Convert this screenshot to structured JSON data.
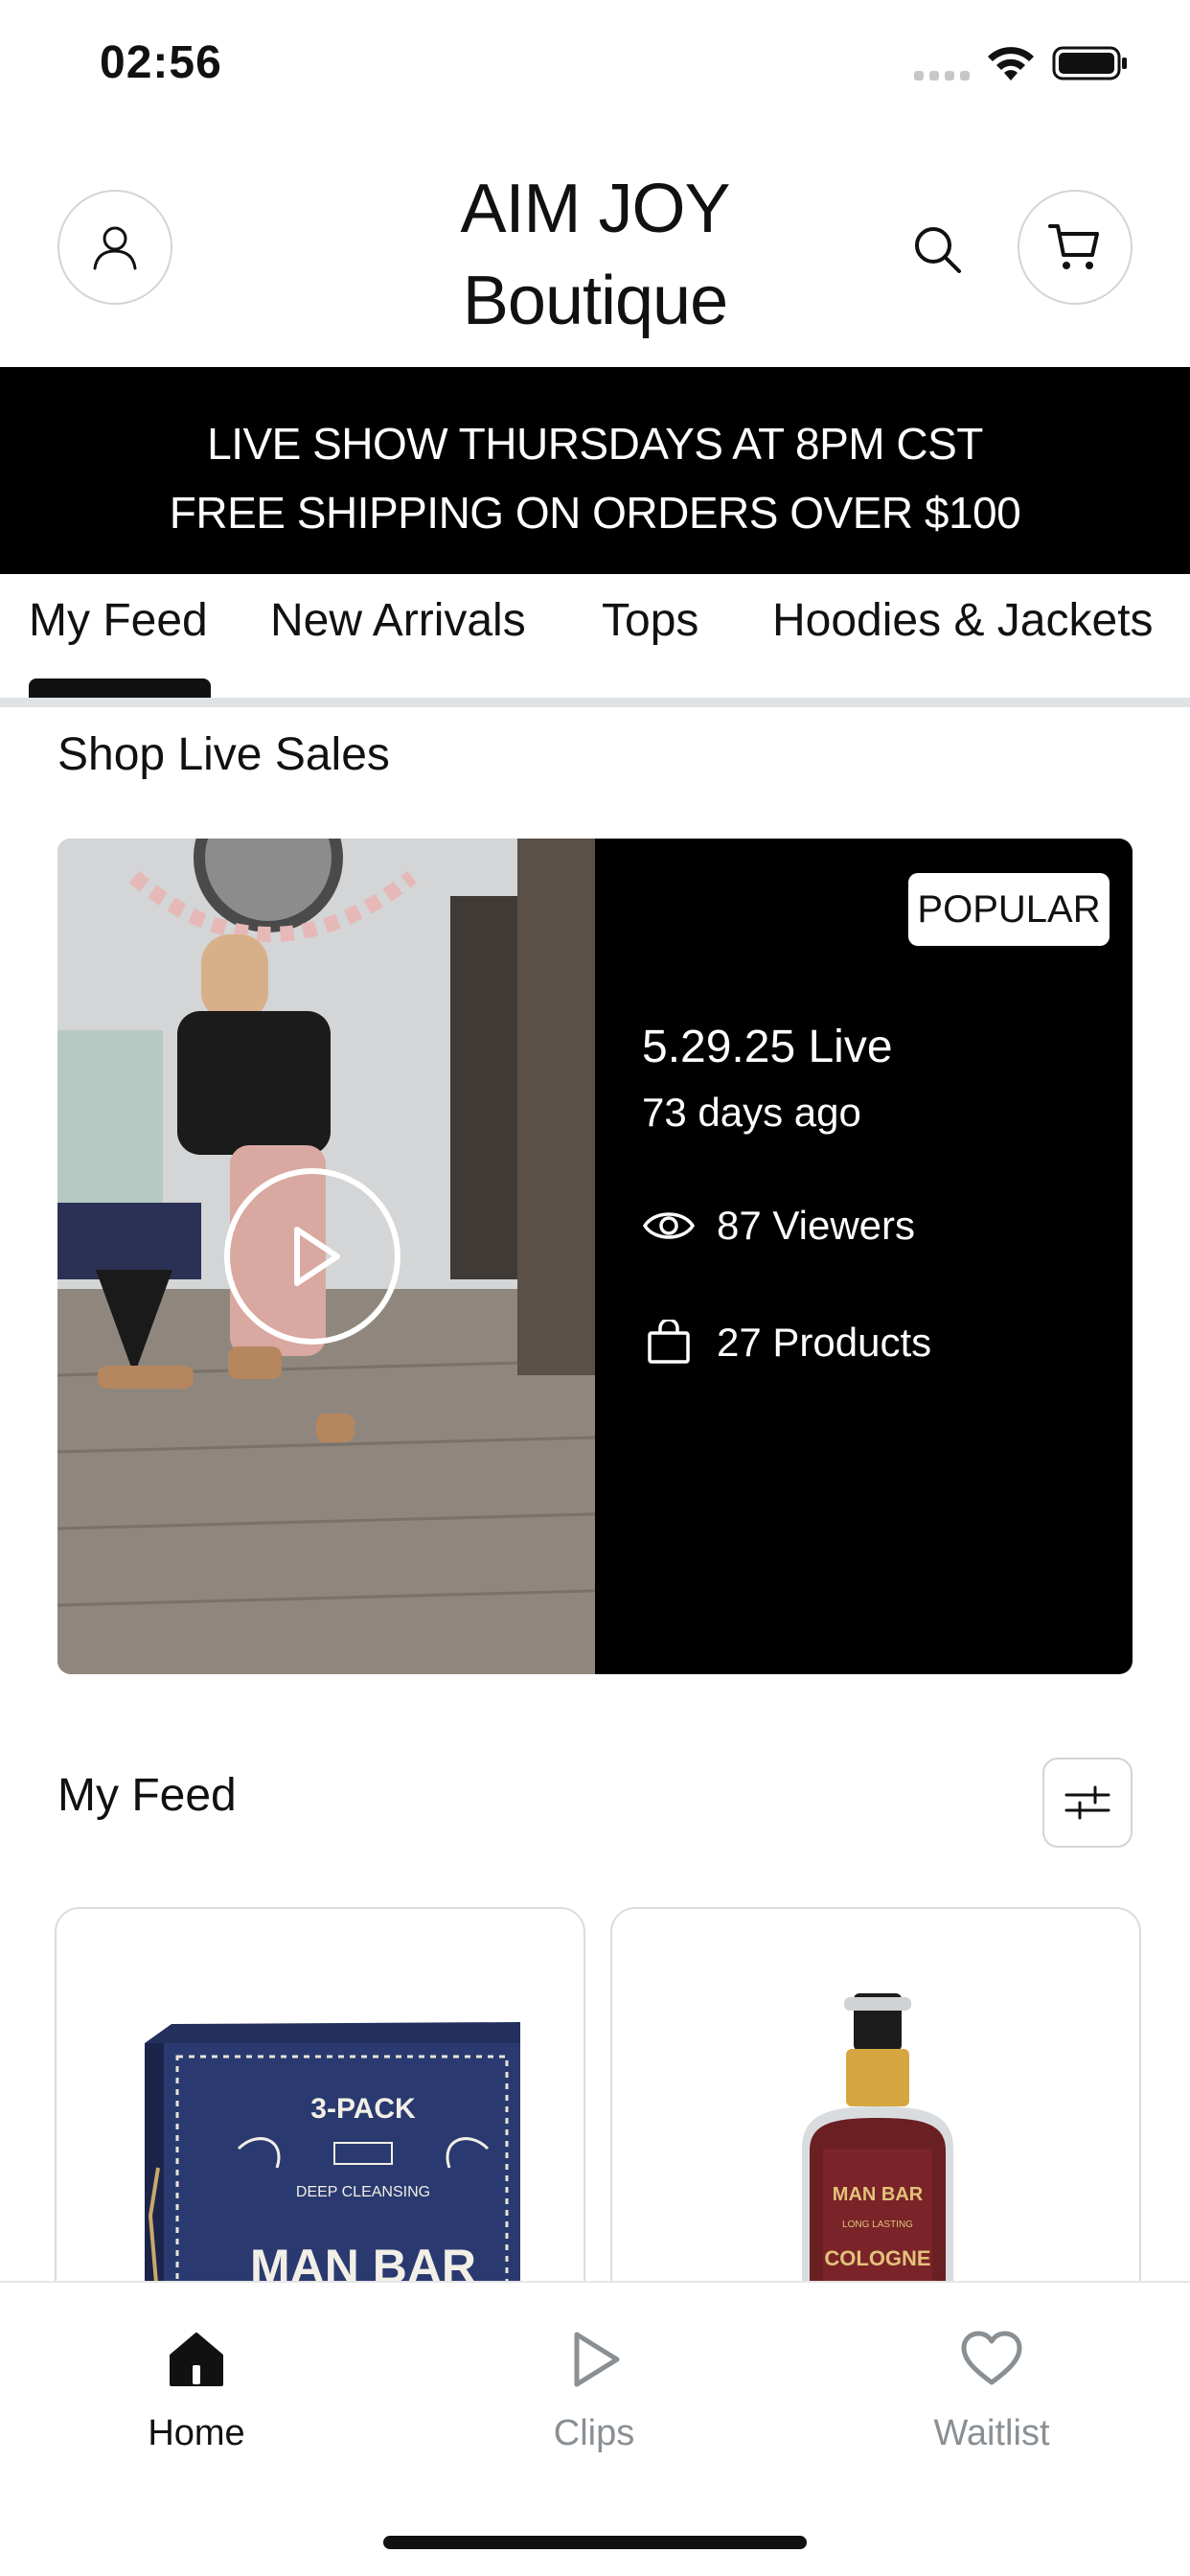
{
  "status_bar": {
    "time": "02:56"
  },
  "header": {
    "brand_line1": "AIM JOY",
    "brand_line2": "Boutique"
  },
  "announcement": {
    "line1": "LIVE SHOW THURSDAYS AT 8PM CST",
    "line2": "FREE SHIPPING ON ORDERS OVER $100"
  },
  "tabs": [
    {
      "label": "My Feed",
      "active": true
    },
    {
      "label": "New Arrivals"
    },
    {
      "label": "Tops"
    },
    {
      "label": "Hoodies & Jackets"
    }
  ],
  "live_section": {
    "title": "Shop Live Sales",
    "card": {
      "badge": "POPULAR",
      "title": "5.29.25 Live",
      "ago": "73 days ago",
      "viewers": "87 Viewers",
      "products": "27 Products"
    }
  },
  "feed_section": {
    "title": "My Feed"
  },
  "bottom_nav": [
    {
      "label": "Home",
      "icon": "home-icon",
      "active": true
    },
    {
      "label": "Clips",
      "icon": "play-icon"
    },
    {
      "label": "Waitlist",
      "icon": "heart-icon"
    }
  ],
  "colors": {
    "accent": "#000000",
    "inactive": "#8a8f93",
    "divider": "#dfe3e6"
  }
}
